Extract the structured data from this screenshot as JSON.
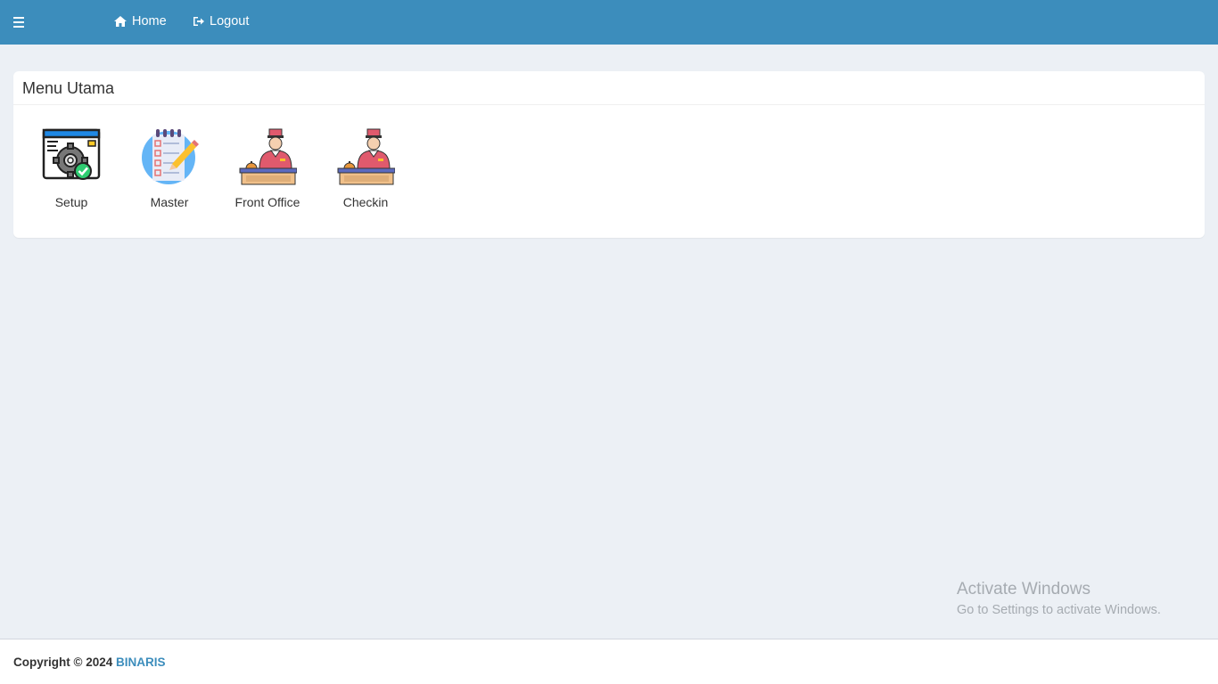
{
  "navbar": {
    "toggle_icon": "hamburger-icon",
    "home_icon": "home-icon",
    "home_label": "Home",
    "logout_icon": "sign-out-icon",
    "logout_label": "Logout",
    "bg_color": "#3c8dbc"
  },
  "menu": {
    "title": "Menu Utama",
    "items": [
      {
        "label": "Setup",
        "icon": "settings-window-icon"
      },
      {
        "label": "Master",
        "icon": "checklist-notepad-icon"
      },
      {
        "label": "Front Office",
        "icon": "receptionist-desk-icon"
      },
      {
        "label": "Checkin",
        "icon": "receptionist-desk-icon"
      }
    ]
  },
  "watermark": {
    "line1": "Activate Windows",
    "line2": "Go to Settings to activate Windows."
  },
  "footer": {
    "copyright": "Copyright © 2024",
    "brand": "BINARIS",
    "brand_color": "#3c8dbc"
  }
}
